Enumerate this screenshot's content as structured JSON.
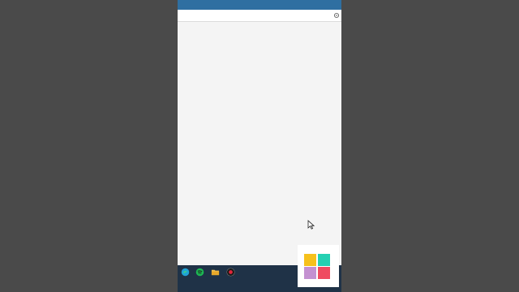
{
  "window": {
    "titlebar_color": "#2f6fa1",
    "content_background": "#f4f4f4"
  },
  "addressbar": {
    "icon": "settings-icon"
  },
  "cursor": {
    "icon": "mouse-pointer-icon"
  },
  "taskbar": {
    "background": "#1f3247",
    "apps": [
      {
        "icon": "edge-icon",
        "label": ""
      },
      {
        "icon": "spotify-icon",
        "label": ""
      },
      {
        "icon": "folder-icon",
        "label": ""
      },
      {
        "icon": "record-icon",
        "label": ""
      }
    ]
  },
  "logo": {
    "icon": "four-tile-logo",
    "colors": [
      "#f6c11c",
      "#25d0b2",
      "#c490d1",
      "#ef4b60"
    ]
  }
}
